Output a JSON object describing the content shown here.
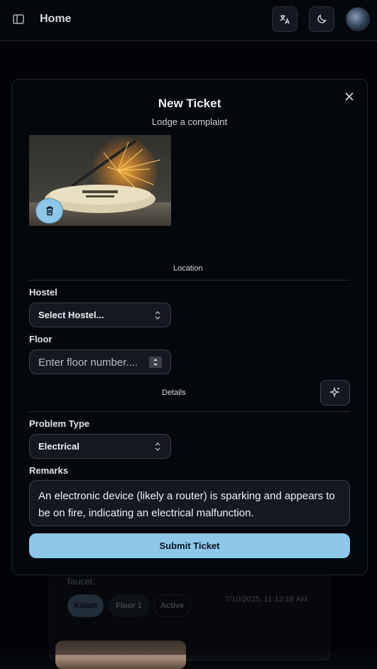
{
  "topbar": {
    "title": "Home",
    "icons": [
      "sidebar-icon",
      "translate-icon",
      "moon-icon",
      "avatar"
    ]
  },
  "background_card": {
    "text": "faucet.",
    "badges": [
      "Kalam",
      "Floor 1",
      "Active"
    ],
    "date": "7/10/2025, 11:13:16 AM"
  },
  "modal": {
    "title": "New Ticket",
    "subtitle": "Lodge a complaint",
    "location_section": "Location",
    "hostel_label": "Hostel",
    "hostel_value": "Select Hostel...",
    "floor_label": "Floor",
    "floor_placeholder": "Enter floor number....",
    "details_section": "Details",
    "problem_type_label": "Problem Type",
    "problem_type_value": "Electrical",
    "remarks_label": "Remarks",
    "remarks_value": "An electronic device (likely a router) is sparking and appears to be on fire, indicating an electrical malfunction.",
    "submit_label": "Submit Ticket"
  },
  "colors": {
    "accent": "#8dc7ea",
    "background": "#04070c",
    "field_bg": "#141921",
    "border": "#3a414c"
  }
}
